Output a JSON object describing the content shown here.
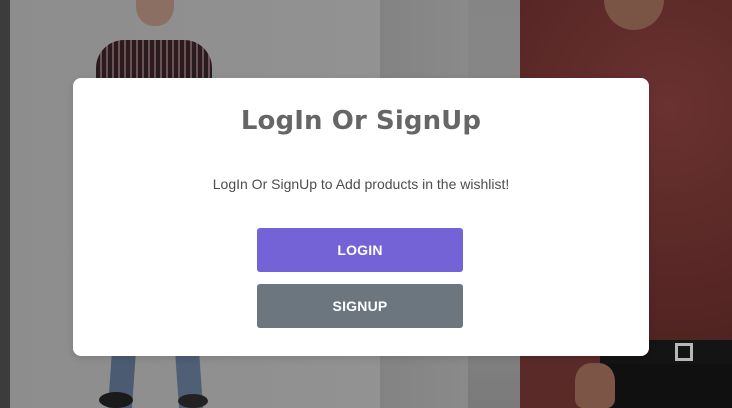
{
  "modal": {
    "title": "LogIn Or SignUp",
    "subtitle": "LogIn Or SignUp to Add products in the wishlist!",
    "buttons": {
      "login_label": "LOGIN",
      "signup_label": "SIGNUP"
    }
  },
  "colors": {
    "login_button": "#7463d6",
    "signup_button": "#6b767f",
    "modal_background": "#ffffff",
    "title_text": "#666666",
    "body_text": "#4d4d4d"
  }
}
